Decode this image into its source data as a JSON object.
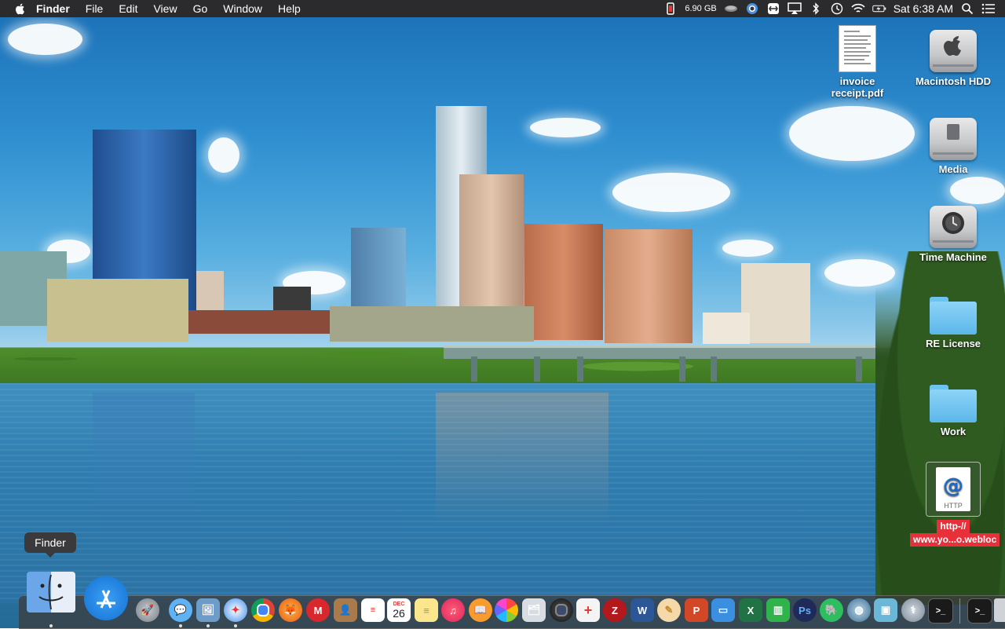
{
  "menubar": {
    "app_name": "Finder",
    "menus": [
      "File",
      "Edit",
      "View",
      "Go",
      "Window",
      "Help"
    ],
    "memory": "6.90 GB",
    "clock": "Sat 6:38 AM",
    "status_icons": [
      "memory-icon",
      "hdd-activity-icon",
      "colorsync-icon",
      "teamviewer-icon",
      "airplay-icon",
      "bluetooth-icon",
      "time-machine-icon",
      "wifi-icon",
      "battery-charging-icon",
      "spotlight-icon",
      "notification-center-icon"
    ]
  },
  "desktop_icons": {
    "invoice": "invoice receipt.pdf",
    "macintosh_hdd": "Macintosh HDD",
    "media": "Media",
    "time_machine": "Time Machine",
    "re_license": "RE License",
    "work": "Work",
    "webloc_line1": "http-//",
    "webloc_line2": "www.yo...o.webloc",
    "webloc_doc_text": "HTTP"
  },
  "tooltip": "Finder",
  "dock": {
    "calendar_month": "DEC",
    "calendar_day": "26",
    "items": [
      "finder",
      "app-store",
      "launchpad",
      "messages",
      "preview",
      "safari",
      "chrome",
      "firefox",
      "mega",
      "contacts",
      "reminders",
      "calendar",
      "notes",
      "itunes",
      "ibooks",
      "photos",
      "preview-2",
      "photo-booth",
      "text-editor",
      "filezilla",
      "word",
      "pencil",
      "powerpoint",
      "keynote",
      "excel",
      "numbers",
      "photoshop",
      "evernote",
      "network-utility",
      "virtualbox",
      "disk-utility",
      "terminal",
      "terminal-2",
      "trash"
    ]
  },
  "colors": {
    "menubar_bg": "#2b2b2d",
    "folder_blue": "#6cc3f0",
    "webloc_label_bg": "#e8303a",
    "accent_blue": "#1e88e5"
  }
}
